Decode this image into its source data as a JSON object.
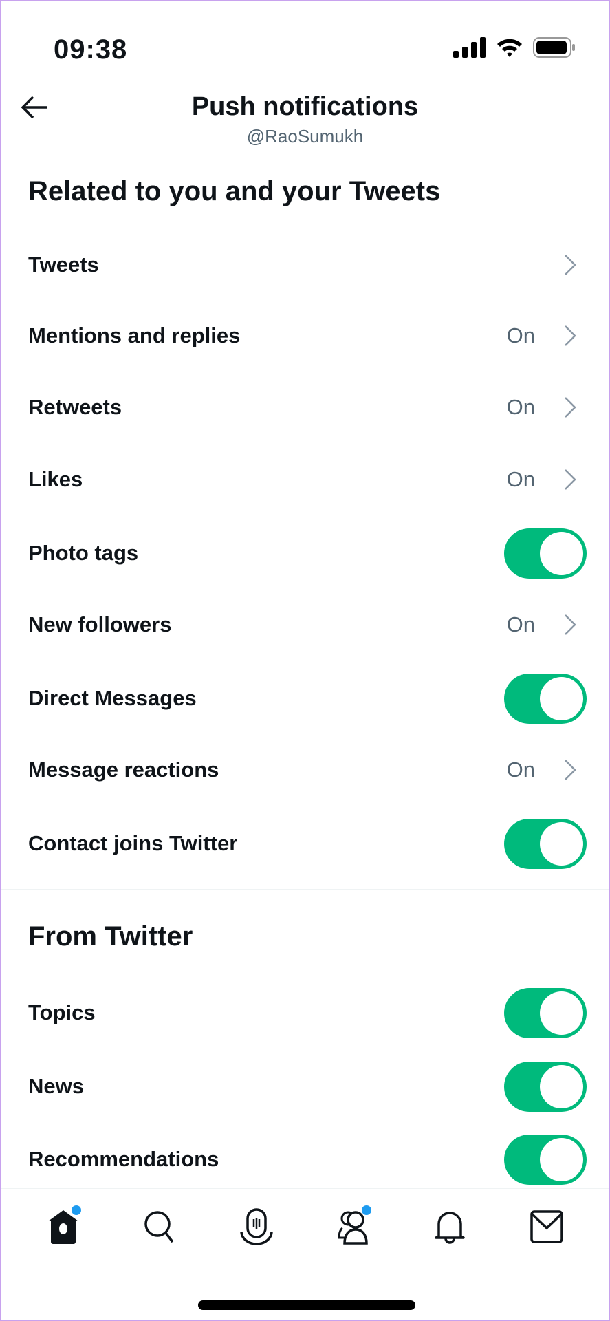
{
  "status_bar": {
    "time": "09:38"
  },
  "header": {
    "title": "Push notifications",
    "handle": "@RaoSumukh"
  },
  "sections": [
    {
      "heading": "Related to you and your Tweets",
      "items": [
        {
          "label": "Tweets",
          "type": "link",
          "value": ""
        },
        {
          "label": "Mentions and replies",
          "type": "link",
          "value": "On"
        },
        {
          "label": "Retweets",
          "type": "link",
          "value": "On"
        },
        {
          "label": "Likes",
          "type": "link",
          "value": "On"
        },
        {
          "label": "Photo tags",
          "type": "toggle",
          "checked": true
        },
        {
          "label": "New followers",
          "type": "link",
          "value": "On"
        },
        {
          "label": "Direct Messages",
          "type": "toggle",
          "checked": true
        },
        {
          "label": "Message reactions",
          "type": "link",
          "value": "On"
        },
        {
          "label": "Contact joins Twitter",
          "type": "toggle",
          "checked": true
        }
      ]
    },
    {
      "heading": "From Twitter",
      "items": [
        {
          "label": "Topics",
          "type": "toggle",
          "checked": true
        },
        {
          "label": "News",
          "type": "toggle",
          "checked": true
        },
        {
          "label": "Recommendations",
          "type": "toggle",
          "checked": true
        }
      ]
    }
  ],
  "bottom_nav": [
    {
      "icon": "home-icon",
      "active": true,
      "badge": true
    },
    {
      "icon": "search-icon",
      "badge": false
    },
    {
      "icon": "spaces-icon",
      "badge": false
    },
    {
      "icon": "communities-icon",
      "badge": true
    },
    {
      "icon": "notifications-icon",
      "badge": false
    },
    {
      "icon": "messages-icon",
      "badge": false
    }
  ],
  "colors": {
    "toggle_on": "#00ba7c",
    "badge": "#1d9bf0",
    "secondary_text": "#536471"
  }
}
